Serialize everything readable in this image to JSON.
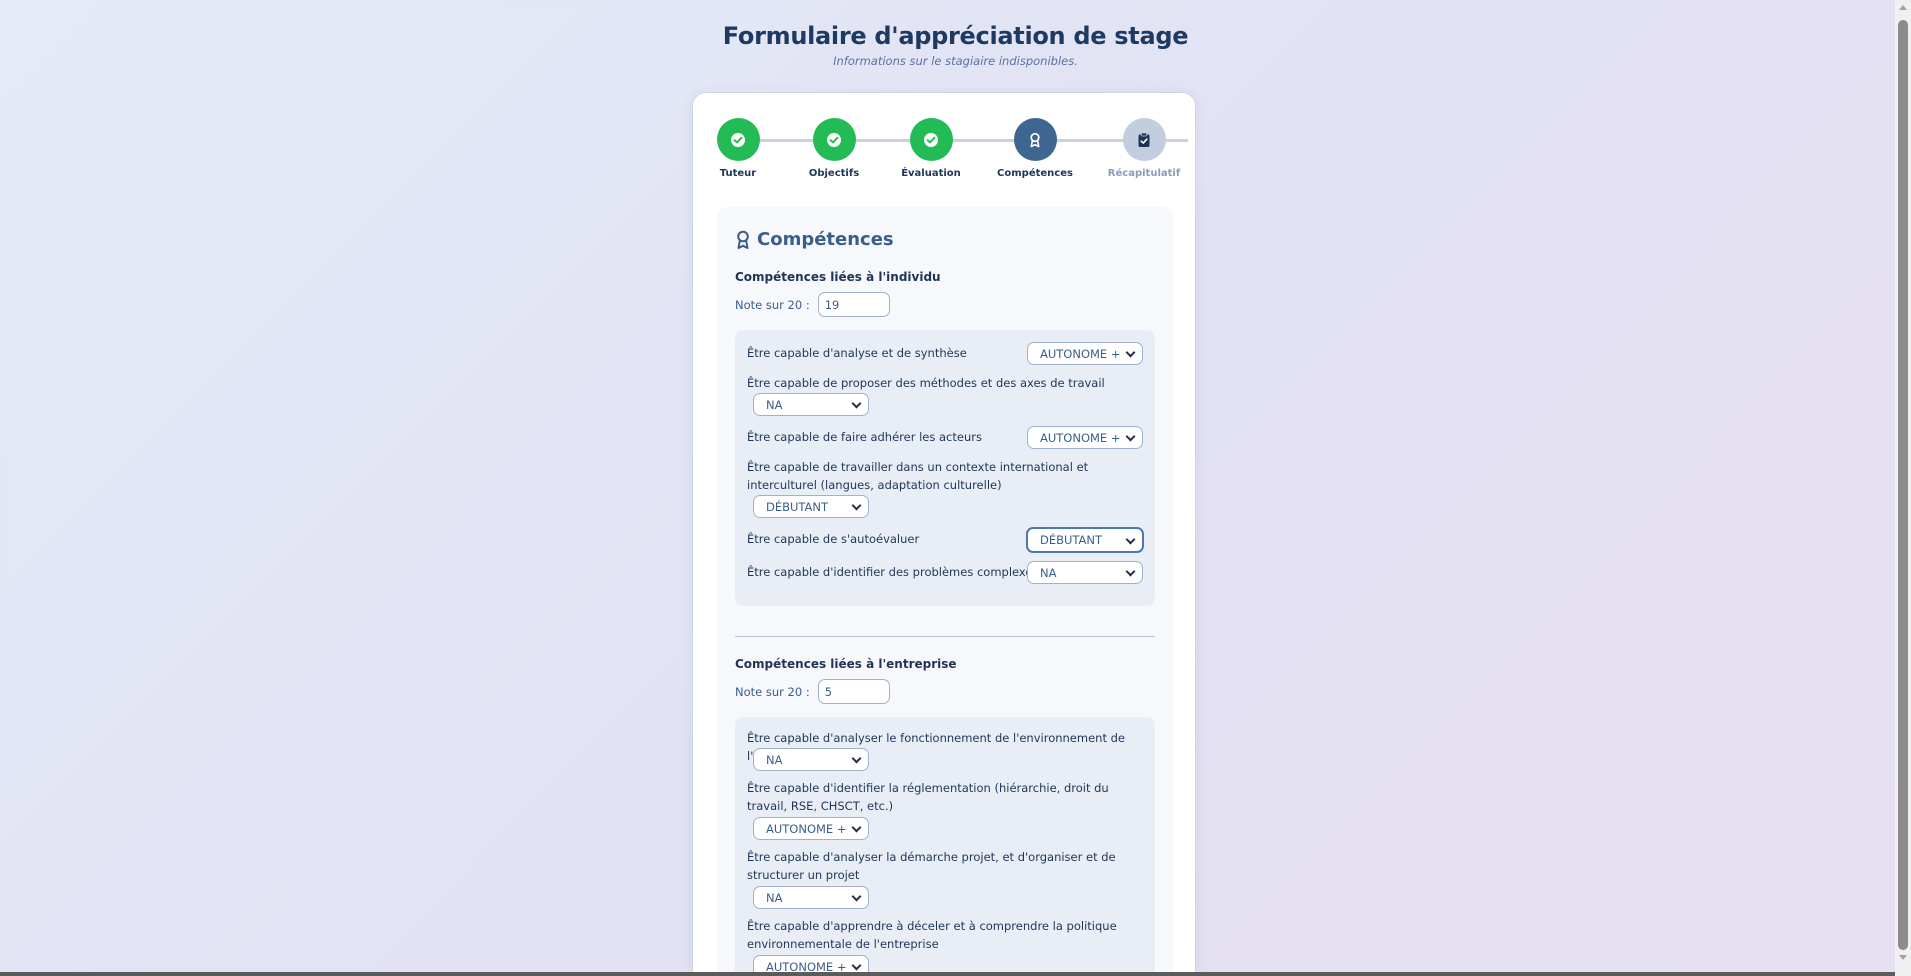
{
  "header": {
    "title": "Formulaire d'appréciation de stage",
    "subtitle": "Informations sur le stagiaire indisponibles."
  },
  "stepper": {
    "steps": [
      {
        "label": "Tuteur",
        "status": "done"
      },
      {
        "label": "Objectifs",
        "status": "done"
      },
      {
        "label": "Évaluation",
        "status": "done"
      },
      {
        "label": "Compétences",
        "status": "active"
      },
      {
        "label": "Récapitulatif",
        "status": "pending"
      }
    ]
  },
  "section": {
    "title": "Compétences"
  },
  "individu": {
    "title": "Compétences liées à l'individu",
    "note_label": "Note sur 20 :",
    "note_value": "19",
    "criteria": [
      {
        "label": "Être capable d'analyse et de synthèse",
        "value": "AUTONOME +"
      },
      {
        "label": "Être capable de proposer des méthodes et des axes de travail",
        "value": "NA"
      },
      {
        "label": "Être capable de faire adhérer les acteurs",
        "value": "AUTONOME +"
      },
      {
        "label": "Être capable de travailler dans un contexte international et interculturel (langues, adaptation culturelle)",
        "value": "DÉBUTANT"
      },
      {
        "label": "Être capable de s'autoévaluer",
        "value": "DÉBUTANT"
      },
      {
        "label": "Être capable d'identifier des problèmes complexes",
        "value": "NA"
      }
    ]
  },
  "entreprise": {
    "title": "Compétences liées à l'entreprise",
    "note_label": "Note sur 20 :",
    "note_value": "5",
    "criteria": [
      {
        "label": "Être capable d'analyser le fonctionnement de l'environnement de l'accueil",
        "value": "NA"
      },
      {
        "label": "Être capable d'identifier la réglementation (hiérarchie, droit du travail, RSE, CHSCT, etc.)",
        "value": "AUTONOME +"
      },
      {
        "label": "Être capable d'analyser la démarche projet, et d'organiser et de structurer un projet",
        "value": "NA"
      },
      {
        "label": "Être capable d'apprendre à déceler et à comprendre la politique environnementale de l'entreprise",
        "value": "AUTONOME +"
      }
    ]
  },
  "colors": {
    "done": "#22bb55",
    "active": "#3f6690",
    "pending": "#c3cde0",
    "title": "#1e3a62"
  },
  "icons": {
    "done_step": "check-circle-icon",
    "active_step": "award-icon",
    "pending_step": "clipboard-check-icon",
    "section": "award-icon"
  }
}
